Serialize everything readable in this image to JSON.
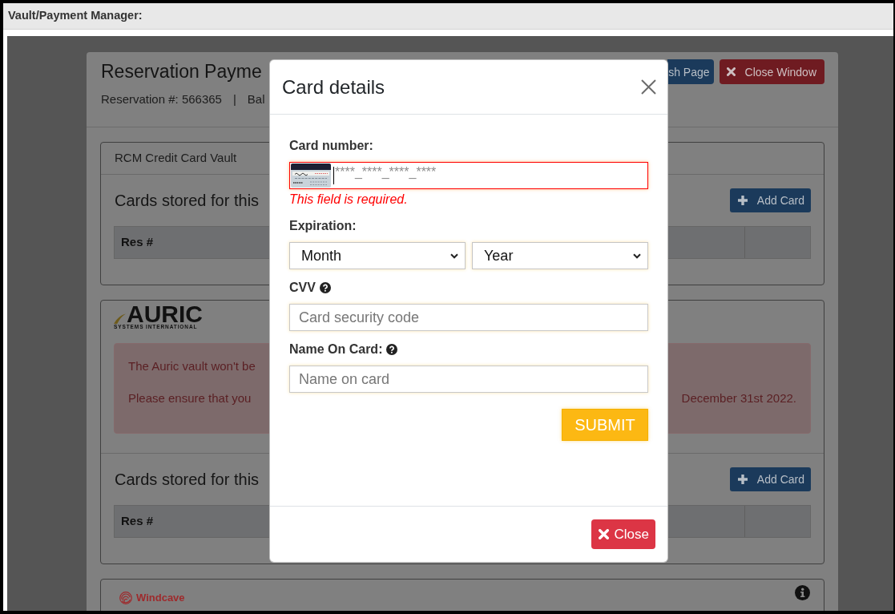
{
  "window": {
    "title": "Vault/Payment Manager:"
  },
  "page": {
    "title": "Reservation Payme",
    "reservation": "Reservation #: 566365",
    "separator": "|",
    "balance": "Bal",
    "buttons": [
      {
        "kind": "refresh",
        "label": "sh Page"
      },
      {
        "kind": "close",
        "label": "Close Window"
      }
    ]
  },
  "vaults": [
    {
      "kind": "rcm",
      "header": "RCM Credit Card Vault",
      "sections": [
        {
          "heading": "Cards stored for this",
          "button": "Add Card",
          "columns": [
            "Res #"
          ]
        }
      ]
    },
    {
      "kind": "auric",
      "logo": {
        "name": "AURIC",
        "tagline": "SYSTEMS INTERNATIONAL"
      },
      "alert": [
        [
          "The Auric vault won't be"
        ],
        [
          "Please ensure that you",
          "December 31st 2022."
        ]
      ],
      "sections": [
        {
          "heading": "Cards stored for this",
          "button": "Add Card",
          "columns": [
            "Res #"
          ]
        }
      ]
    },
    {
      "kind": "windcave",
      "logo": {
        "name": "Windcave"
      }
    }
  ],
  "modal": {
    "title": "Card details",
    "fields": [
      {
        "kind": "card",
        "label": "Card number:",
        "help": false,
        "placeholder": "****_****_****_****",
        "focused": true,
        "invalid": true,
        "error": "This field is required."
      },
      {
        "kind": "pair",
        "label": "Expiration:",
        "help": false,
        "selects": [
          "Month",
          "Year"
        ]
      },
      {
        "kind": "text",
        "label": "CVV",
        "help": true,
        "placeholder": "Card security code",
        "focused": false,
        "invalid": false
      },
      {
        "kind": "text",
        "label": "Name On Card:",
        "help": true,
        "placeholder": "Name on card",
        "focused": false,
        "invalid": false
      }
    ],
    "submit": "SUBMIT",
    "close": "Close"
  }
}
